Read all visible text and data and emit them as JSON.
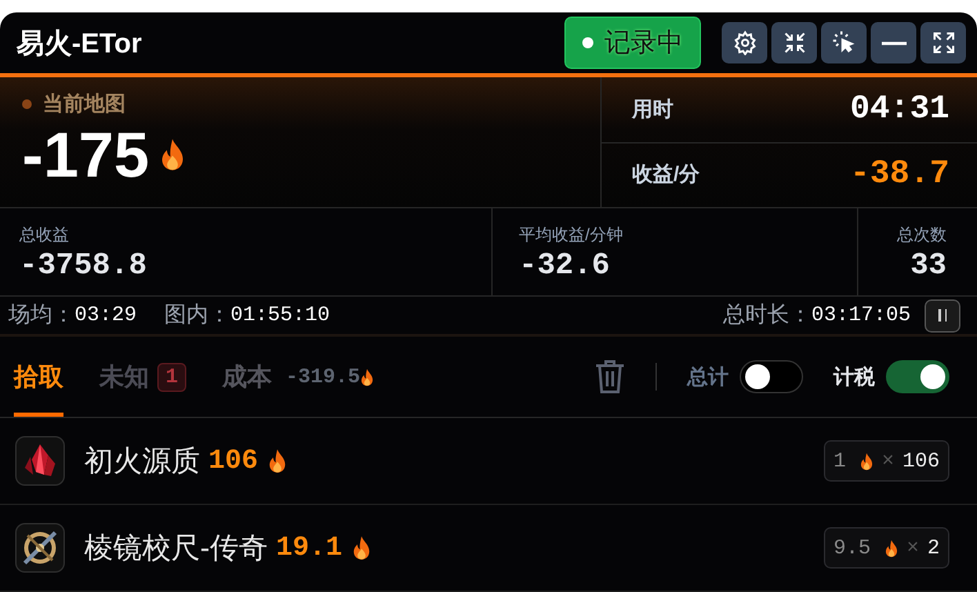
{
  "app": {
    "title": "易火-ETor",
    "recording": {
      "label": "记录中",
      "on": true
    }
  },
  "toolbar": [
    {
      "kind": "settings"
    },
    {
      "kind": "collapse"
    },
    {
      "kind": "clickthrough"
    },
    {
      "kind": "minimize"
    },
    {
      "kind": "expand"
    }
  ],
  "current_map": {
    "label": "当前地图",
    "value": "-175"
  },
  "time": {
    "label": "用时",
    "value": "04:31"
  },
  "rate": {
    "label": "收益/分",
    "value": "-38.7"
  },
  "stats": [
    {
      "label": "总收益",
      "value": "-3758.8"
    },
    {
      "label": "平均收益/分钟",
      "value": "-32.6"
    },
    {
      "label": "总次数",
      "value": "33"
    }
  ],
  "footer": {
    "avg_label": "场均：",
    "avg": "03:29",
    "inmap_label": "图内：",
    "inmap": "01:55:10",
    "total_label": "总时长：",
    "total": "03:17:05"
  },
  "tabs": [
    {
      "label": "拾取",
      "selected": true
    },
    {
      "label": "未知",
      "selected": false,
      "badge": "1"
    }
  ],
  "cost": {
    "label": "成本",
    "value": "-319.5"
  },
  "toggles": [
    {
      "label": "总计",
      "on": false
    },
    {
      "label": "计税",
      "on": true
    }
  ],
  "items": [
    {
      "kind": "crystal",
      "name": "初火源质",
      "value": "106",
      "unit_price": "1",
      "times": "×",
      "count": "106"
    },
    {
      "kind": "compass",
      "name": "棱镜校尺-传奇",
      "value": "19.1",
      "unit_price": "9.5",
      "times": "×",
      "count": "2"
    }
  ]
}
